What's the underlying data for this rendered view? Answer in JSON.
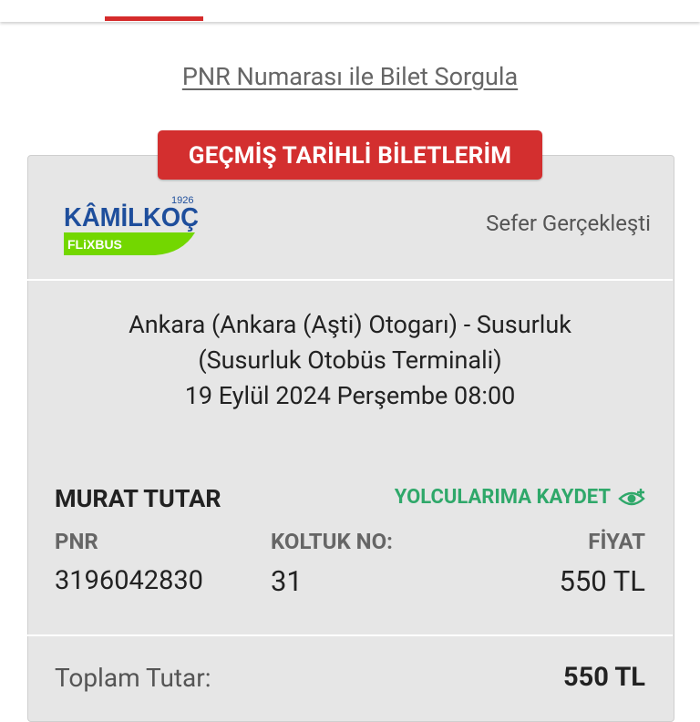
{
  "header": {
    "pnr_link_label": "PNR Numarası ile Bilet Sorgula"
  },
  "history_button_label": "GEÇMİŞ TARİHLİ BİLETLERİM",
  "ticket": {
    "company": {
      "name": "KÂMİLKOÇ",
      "year": "1926",
      "sub_brand": "FLiXBUS"
    },
    "status": "Sefer Gerçekleşti",
    "route_line1": "Ankara (Ankara (Aşti) Otogarı) - Susurluk",
    "route_line2": "(Susurluk Otobüs Terminali)",
    "datetime": "19 Eylül 2024 Perşembe 08:00",
    "passenger_name": "MURAT TUTAR",
    "save_label": "YOLCULARIMA KAYDET",
    "pnr_label": "PNR",
    "pnr_value": "3196042830",
    "seat_label": "KOLTUK NO:",
    "seat_value": "31",
    "price_label": "FİYAT",
    "price_value": "550 TL",
    "total_label": "Toplam Tutar:",
    "total_value": "550 TL"
  },
  "colors": {
    "brand_red": "#d32f2f",
    "save_green": "#2fa86a",
    "logo_blue": "#1e4e9c",
    "flix_green": "#73d700"
  },
  "icons": {
    "save_icon": "add-passenger-eye-icon"
  }
}
